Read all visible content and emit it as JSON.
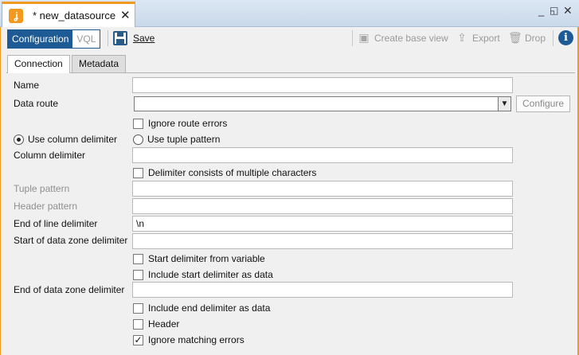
{
  "window": {
    "tab_title": "* new_datasource",
    "app_icon": "denodo-icon",
    "close_glyph": "✕",
    "min_glyph": "_",
    "max_glyph": "◱",
    "win_close_glyph": "✕"
  },
  "toolbar": {
    "mode_active": "Configuration",
    "mode_inactive": "VQL",
    "save_label": "Save",
    "create_base_view_label": "Create base view",
    "export_label": "Export",
    "drop_label": "Drop",
    "info_glyph": "i"
  },
  "tabs": [
    {
      "label": "Connection",
      "active": true
    },
    {
      "label": "Metadata",
      "active": false
    }
  ],
  "form": {
    "name_label": "Name",
    "name_value": "",
    "data_route_label": "Data route",
    "data_route_value": "",
    "configure_label": "Configure",
    "ignore_route_errors_label": "Ignore route errors",
    "ignore_route_errors_checked": false,
    "use_column_delimiter_label": "Use column delimiter",
    "use_tuple_pattern_label": "Use tuple pattern",
    "column_delimiter_label": "Column delimiter",
    "column_delimiter_value": "",
    "multi_char_delimiter_label": "Delimiter consists of multiple characters",
    "tuple_pattern_label": "Tuple pattern",
    "header_pattern_label": "Header pattern",
    "end_of_line_label": "End of line delimiter",
    "end_of_line_value": "\\n",
    "start_zone_label": "Start of data zone delimiter",
    "start_zone_value": "",
    "start_from_variable_label": "Start delimiter from variable",
    "include_start_label": "Include start delimiter as data",
    "end_zone_label": "End of data zone delimiter",
    "end_zone_value": "",
    "include_end_label": "Include end delimiter as data",
    "header_label": "Header",
    "ignore_matching_label": "Ignore matching errors",
    "check_glyph": "✓"
  },
  "colors": {
    "accent_orange": "#f29a1f",
    "selected_blue": "#1e5a94"
  }
}
